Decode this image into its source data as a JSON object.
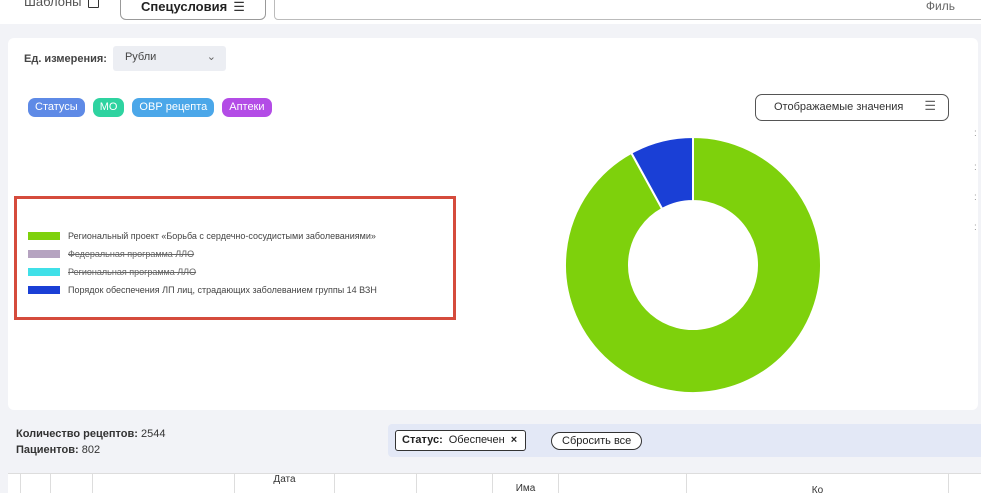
{
  "toolbar": {
    "templates_label": "Шаблоны",
    "special_conditions_label": "Спецусловия",
    "filter_label": "Филь"
  },
  "units": {
    "label": "Ед. измерения:",
    "selected": "Рубли"
  },
  "tags": [
    "Статусы",
    "МО",
    "ОВР рецепта",
    "Аптеки"
  ],
  "display_values_button": "Отображаемые значения",
  "legend": [
    {
      "label": "Региональный проект «Борьба с сердечно-сосудистыми заболеваниями»",
      "color": "#7ed10c",
      "hidden": false
    },
    {
      "label": "Федеральная программа ЛЛО",
      "color": "#b5a3c0",
      "hidden": true
    },
    {
      "label": "Региональная программа ЛЛО",
      "color": "#40e0e8",
      "hidden": true
    },
    {
      "label": "Порядок обеспечения ЛП лиц, страдающих заболеванием группы 14 ВЗН",
      "color": "#1a3fd6",
      "hidden": false
    }
  ],
  "chart_data": {
    "type": "pie",
    "donut": true,
    "slices": [
      {
        "label": "Региональный проект «Борьба с сердечно-сосудистыми заболеваниями»",
        "fraction": 0.92,
        "color": "#7ed10c"
      },
      {
        "label": "Порядок обеспечения ЛП лиц, страдающих заболеванием группы 14 ВЗН",
        "fraction": 0.08,
        "color": "#1a3fd6"
      }
    ]
  },
  "summary": {
    "prescriptions_label": "Количество рецептов:",
    "prescriptions_value": "2544",
    "patients_label": "Пациентов:",
    "patients_value": "802"
  },
  "filters": {
    "status_label": "Статус:",
    "status_value": "Обеспечен",
    "remove_icon": "×",
    "reset_label": "Сбросить все"
  },
  "table_headers": [
    "Дата",
    "Има",
    "Ко"
  ]
}
